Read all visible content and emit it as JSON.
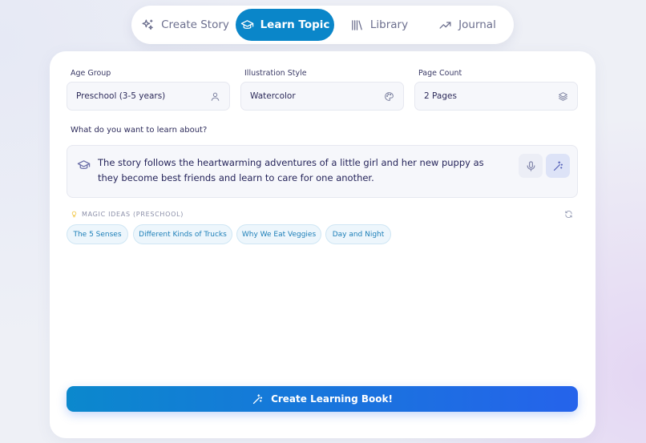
{
  "nav": {
    "items": [
      {
        "label": "Create Story",
        "icon": "sparkles-icon",
        "active": false
      },
      {
        "label": "Learn Topic",
        "icon": "graduation-cap-icon",
        "active": true
      },
      {
        "label": "Library",
        "icon": "library-icon",
        "active": false
      },
      {
        "label": "Journal",
        "icon": "trending-up-icon",
        "active": false
      }
    ]
  },
  "form": {
    "age_group": {
      "label": "Age Group",
      "value": "Preschool (3-5 years)",
      "icon": "user-icon"
    },
    "illustration_style": {
      "label": "Illustration Style",
      "value": "Watercolor",
      "icon": "palette-icon"
    },
    "page_count": {
      "label": "Page Count",
      "value": "2 Pages",
      "icon": "layers-icon"
    },
    "topic_question": "What do you want to learn about?",
    "topic_text": "The story follows the heartwarming adventures of a little girl and her new puppy as they become best friends and learn to care for one another."
  },
  "ideas": {
    "heading": "MAGIC IDEAS (PRESCHOOL)",
    "chips": [
      "The 5 Senses",
      "Different Kinds of Trucks",
      "Why We Eat Veggies",
      "Day and Night"
    ]
  },
  "cta": {
    "label": "Create Learning Book!",
    "icon": "magic-wand-icon"
  },
  "colors": {
    "accent": "#0a86c9",
    "cta_end": "#2563eb",
    "chip_bg": "#edf6fc",
    "chip_text": "#1d7fb8"
  }
}
